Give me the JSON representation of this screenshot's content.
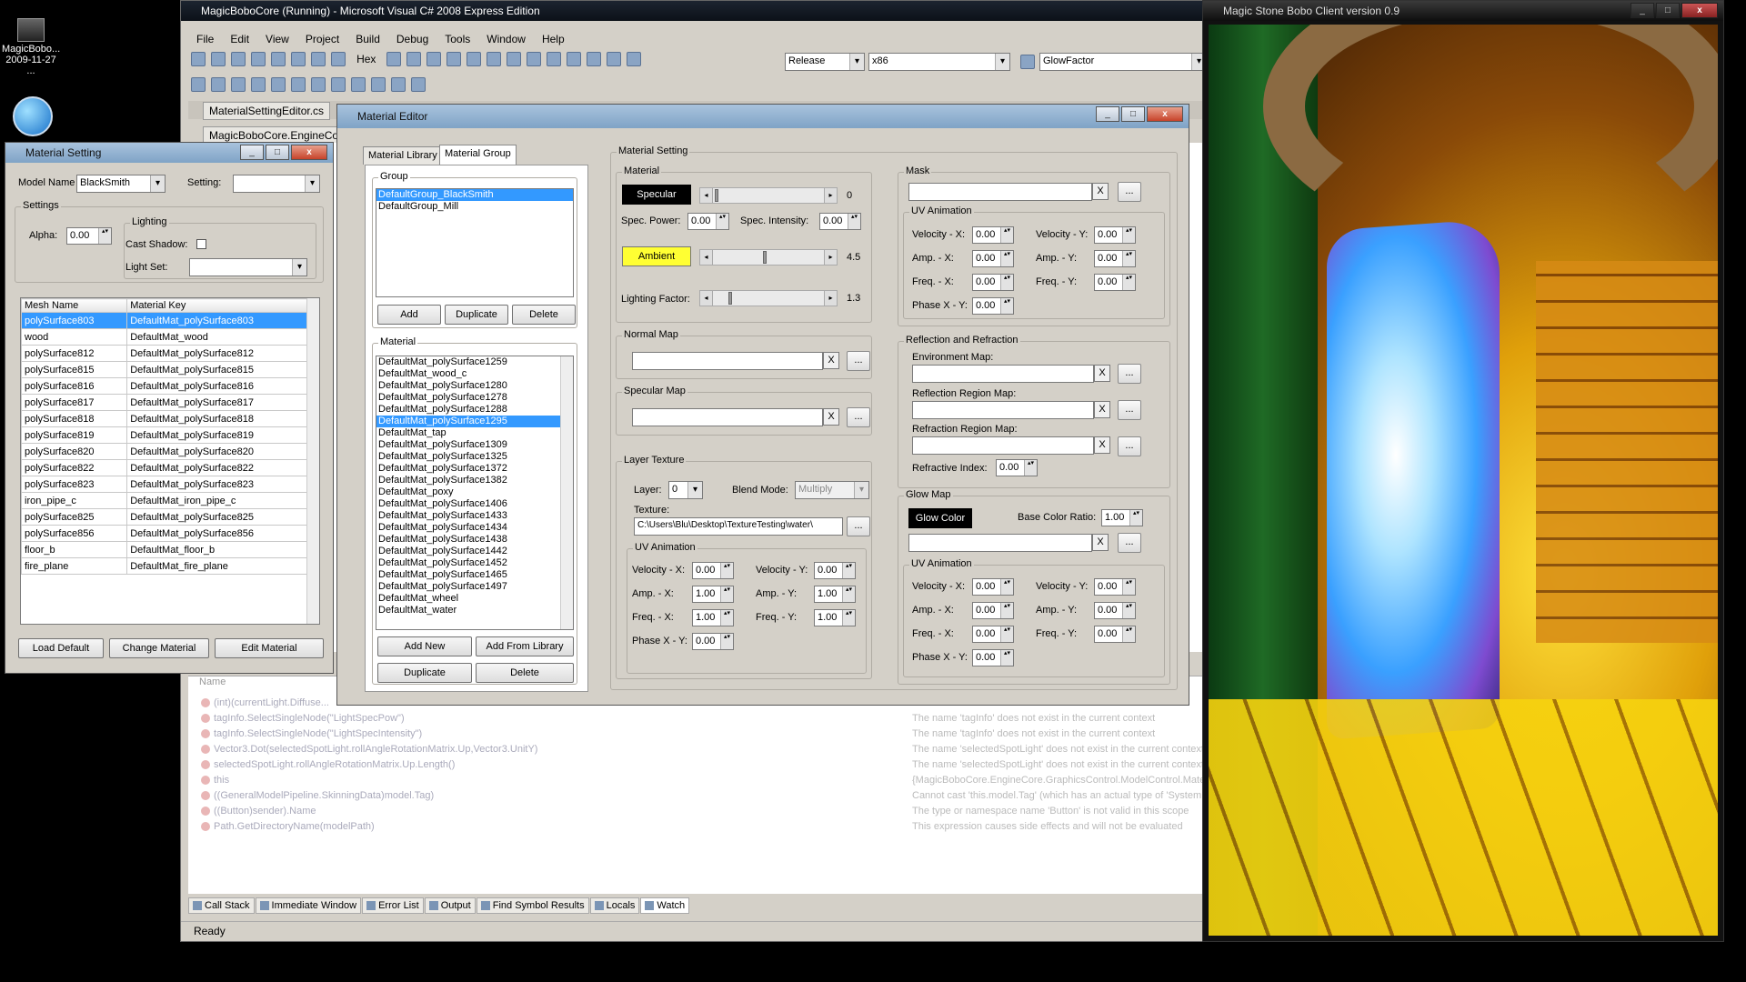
{
  "desktop": {
    "icon1_label": "MagicBobo...",
    "icon1_date": "2009-11-27 ..."
  },
  "vs": {
    "title": "MagicBoboCore (Running) - Microsoft Visual C# 2008 Express Edition",
    "menu": [
      "File",
      "Edit",
      "View",
      "Project",
      "Build",
      "Debug",
      "Tools",
      "Window",
      "Help"
    ],
    "hex_label": "Hex",
    "config_value": "Release",
    "platform_value": "x86",
    "find_value": "GlowFactor",
    "doc_tab1": "MaterialSettingEditor.cs",
    "doc_tab2": "MagicBoboCore.EngineCo",
    "watch_name_header": "Name",
    "watch_rows": [
      {
        "expr": "(int)(currentLight.Diffuse...",
        "msg": ""
      },
      {
        "expr": "tagInfo.SelectSingleNode(\"LightSpecPow\")",
        "msg": "The name 'tagInfo' does not exist in the current context"
      },
      {
        "expr": "tagInfo.SelectSingleNode(\"LightSpecIntensity\")",
        "msg": "The name 'tagInfo' does not exist in the current context"
      },
      {
        "expr": "Vector3.Dot(selectedSpotLight.rollAngleRotationMatrix.Up,Vector3.UnitY)",
        "msg": "The name 'selectedSpotLight' does not exist in the current context"
      },
      {
        "expr": "selectedSpotLight.rollAngleRotationMatrix.Up.Length()",
        "msg": "The name 'selectedSpotLight' does not exist in the current context"
      },
      {
        "expr": "this",
        "msg": "{MagicBoboCore.EngineCore.GraphicsControl.ModelControl.Mater"
      },
      {
        "expr": "((GeneralModelPipeline.SkinningData)model.Tag)",
        "msg": "Cannot cast 'this.model.Tag' (which has an actual type of 'System."
      },
      {
        "expr": "((Button)sender).Name",
        "msg": "The type or namespace name 'Button' is not valid in this scope"
      },
      {
        "expr": "Path.GetDirectoryName(modelPath)",
        "msg": "This expression causes side effects and will not be evaluated"
      }
    ],
    "bottom_tabs": [
      "Call Stack",
      "Immediate Window",
      "Error List",
      "Output",
      "Find Symbol Results",
      "Locals",
      "Watch"
    ],
    "status": "Ready"
  },
  "material_setting": {
    "title": "Material Setting",
    "model_name_label": "Model Name",
    "model_name_value": "BlackSmith",
    "setting_label": "Setting:",
    "setting_value": "",
    "settings_group": "Settings",
    "alpha_label": "Alpha:",
    "alpha_value": "0.00",
    "lighting_group": "Lighting",
    "cast_shadow_label": "Cast Shadow:",
    "light_set_label": "Light Set:",
    "light_set_value": "",
    "grid_headers": [
      "Mesh Name",
      "Material Key"
    ],
    "grid_rows": [
      [
        "polySurface803",
        "DefaultMat_polySurface803"
      ],
      [
        "wood",
        "DefaultMat_wood"
      ],
      [
        "polySurface812",
        "DefaultMat_polySurface812"
      ],
      [
        "polySurface815",
        "DefaultMat_polySurface815"
      ],
      [
        "polySurface816",
        "DefaultMat_polySurface816"
      ],
      [
        "polySurface817",
        "DefaultMat_polySurface817"
      ],
      [
        "polySurface818",
        "DefaultMat_polySurface818"
      ],
      [
        "polySurface819",
        "DefaultMat_polySurface819"
      ],
      [
        "polySurface820",
        "DefaultMat_polySurface820"
      ],
      [
        "polySurface822",
        "DefaultMat_polySurface822"
      ],
      [
        "polySurface823",
        "DefaultMat_polySurface823"
      ],
      [
        "iron_pipe_c",
        "DefaultMat_iron_pipe_c"
      ],
      [
        "polySurface825",
        "DefaultMat_polySurface825"
      ],
      [
        "polySurface856",
        "DefaultMat_polySurface856"
      ],
      [
        "floor_b",
        "DefaultMat_floor_b"
      ],
      [
        "fire_plane",
        "DefaultMat_fire_plane"
      ]
    ],
    "btn_load_default": "Load Default",
    "btn_change_material": "Change Material",
    "btn_edit_material": "Edit Material"
  },
  "material_editor": {
    "title": "Material Editor",
    "tab_library": "Material Library",
    "tab_group": "Material Group",
    "group_caption": "Group",
    "groups": [
      "DefaultGroup_BlackSmith",
      "DefaultGroup_Mill"
    ],
    "btn_add": "Add",
    "btn_duplicate": "Duplicate",
    "btn_delete": "Delete",
    "material_caption": "Material",
    "materials": [
      "DefaultMat_polySurface1259",
      "DefaultMat_wood_c",
      "DefaultMat_polySurface1280",
      "DefaultMat_polySurface1278",
      "DefaultMat_polySurface1288",
      "DefaultMat_polySurface1295",
      "DefaultMat_tap",
      "DefaultMat_polySurface1309",
      "DefaultMat_polySurface1325",
      "DefaultMat_polySurface1372",
      "DefaultMat_polySurface1382",
      "DefaultMat_poxy",
      "DefaultMat_polySurface1406",
      "DefaultMat_polySurface1433",
      "DefaultMat_polySurface1434",
      "DefaultMat_polySurface1438",
      "DefaultMat_polySurface1442",
      "DefaultMat_polySurface1452",
      "DefaultMat_polySurface1465",
      "DefaultMat_polySurface1497",
      "DefaultMat_wheel",
      "DefaultMat_water"
    ],
    "btn_add_new": "Add New",
    "btn_add_from_library": "Add From Library",
    "btn_duplicate2": "Duplicate",
    "btn_delete2": "Delete",
    "setting_caption": "Material Setting",
    "material_sub": "Material",
    "specular_btn": "Specular",
    "specular_val": "0",
    "spec_power_label": "Spec. Power:",
    "spec_power_value": "0.00",
    "spec_intensity_label": "Spec. Intensity:",
    "spec_intensity_value": "0.00",
    "ambient_btn": "Ambient",
    "ambient_val": "4.5",
    "lighting_factor_label": "Lighting Factor:",
    "lighting_factor_val": "1.3",
    "specular_level": 0.0,
    "ambient_level": 0.45,
    "lighting_level": 0.13,
    "normal_map_caption": "Normal Map",
    "specular_map_caption": "Specular Map",
    "layer_texture_caption": "Layer Texture",
    "layer_label": "Layer:",
    "layer_value": "0",
    "blend_mode_label": "Blend Mode:",
    "blend_mode_value": "Multiply",
    "texture_label": "Texture:",
    "texture_value": "C:\\Users\\Blu\\Desktop\\TextureTesting\\water\\",
    "uv_anim_caption": "UV Animation",
    "vel_x_label": "Velocity - X:",
    "vel_y_label": "Velocity - Y:",
    "amp_x_label": "Amp. - X:",
    "amp_y_label": "Amp. - Y:",
    "freq_x_label": "Freq. - X:",
    "freq_y_label": "Freq. - Y:",
    "phase_label": "Phase X - Y:",
    "layer_uv": {
      "vx": "0.00",
      "vy": "0.00",
      "ax": "1.00",
      "ay": "1.00",
      "fx": "1.00",
      "fy": "1.00",
      "ph": "0.00"
    },
    "mask_caption": "Mask",
    "mask_uv": {
      "vx": "0.00",
      "vy": "0.00",
      "ax": "0.00",
      "ay": "0.00",
      "fx": "0.00",
      "fy": "0.00",
      "ph": "0.00"
    },
    "refl_caption": "Reflection and Refraction",
    "env_map_label": "Environment Map:",
    "refl_region_label": "Reflection Region Map:",
    "refr_region_label": "Refraction Region Map:",
    "refr_index_label": "Refractive Index:",
    "refr_index_value": "0.00",
    "glow_caption": "Glow Map",
    "glow_color_btn": "Glow Color",
    "base_ratio_label": "Base Color Ratio:",
    "base_ratio_value": "1.00",
    "glow_uv": {
      "vx": "0.00",
      "vy": "0.00",
      "ax": "0.00",
      "ay": "0.00",
      "fx": "0.00",
      "fy": "0.00",
      "ph": "0.00"
    },
    "x_label": "X",
    "dots_label": "..."
  },
  "game": {
    "title": "Magic Stone Bobo Client version 0.9"
  },
  "colors": {
    "selection": "#3399ff",
    "ambient": "#ffff33",
    "vs_bg": "#d4d0c8"
  }
}
